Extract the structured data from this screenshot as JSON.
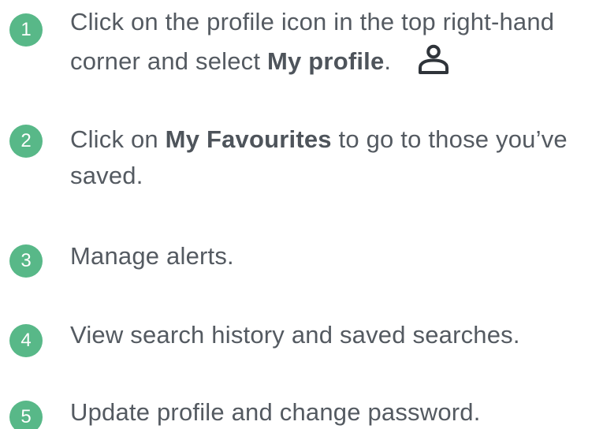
{
  "colors": {
    "badge": "#58b888",
    "text": "#545a61"
  },
  "steps": [
    {
      "number": "1",
      "line1": "Click on the profile icon in the top right-hand",
      "line2_before": "corner and select ",
      "line2_bold": "My profile",
      "line2_after": ".",
      "icon": "person-icon"
    },
    {
      "number": "2",
      "line1_before": "Click on ",
      "line1_bold": "My Favourites",
      "line1_after": " to go to those you’ve",
      "line2": "saved."
    },
    {
      "number": "3",
      "text": "Manage alerts."
    },
    {
      "number": "4",
      "text": "View search history and saved searches."
    },
    {
      "number": "5",
      "text": "Update profile and change password."
    }
  ]
}
